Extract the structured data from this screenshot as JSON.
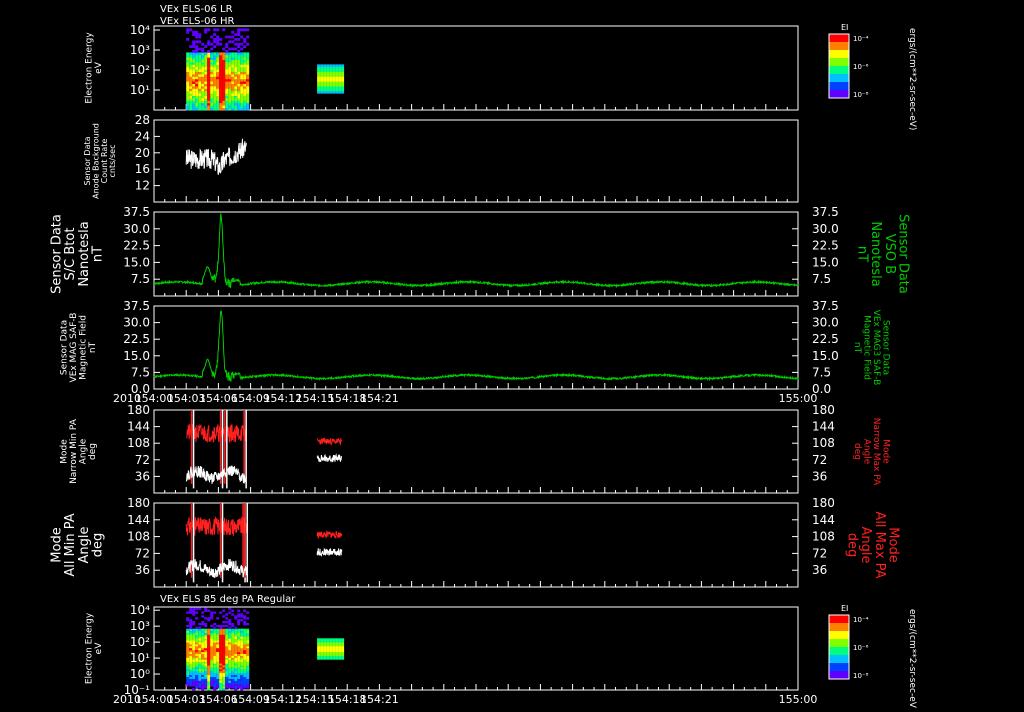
{
  "header": {
    "line1": "VEx ELS-06 LR",
    "line2": "VEx ELS-06 HR"
  },
  "bottom_title": "VEx ELS 85 deg PA Regular",
  "colorbar": {
    "label": "EI",
    "unit": "ergs/(cm**2-sr-sec-eV)",
    "ticks": [
      "10⁻⁴",
      "10⁻⁶",
      "10⁻⁸"
    ],
    "colors": [
      "#ff0000",
      "#ff8000",
      "#ffff00",
      "#80ff00",
      "#00ff80",
      "#00c0ff",
      "#0040ff",
      "#6000ff"
    ]
  },
  "time_axis": {
    "year_label": "2010",
    "ticks": [
      "154:00",
      "154:03",
      "154:06",
      "154:09",
      "154:12",
      "154:15",
      "154:18",
      "154:21",
      "155:00"
    ]
  },
  "colors": {
    "bfield": "#00cc00",
    "minpa": "#ffffff",
    "maxpa": "#ff2020",
    "axis": "#ffffff"
  },
  "chart_data": [
    {
      "type": "heatmap",
      "ylabel": [
        "Electron Energy",
        "eV"
      ],
      "yticks": [
        "10⁴",
        "10³",
        "10²",
        "10¹"
      ],
      "ylog_range": [
        0,
        4.2
      ],
      "coverage_minutes": [
        [
          3.0,
          8.6
        ],
        [
          15.2,
          17.5
        ]
      ]
    },
    {
      "type": "line",
      "ylabel": [
        "Sensor Data",
        "Anode Background",
        "Count Rate",
        "cnts/sec"
      ],
      "yticks": [
        28,
        24,
        20,
        16,
        12
      ],
      "ylim": [
        8,
        28
      ],
      "series": [
        {
          "segment": [
            3.0,
            8.6
          ],
          "seed": 3,
          "shape": "bg"
        }
      ]
    },
    {
      "type": "line",
      "ylabel": [
        "Sensor Data",
        "S/C Btot",
        "Nanotesla",
        "nT"
      ],
      "ylabel_right": [
        "Sensor Data",
        "VSO B",
        "Nanotesla",
        "nT"
      ],
      "yticks": [
        "37.5",
        "30.0",
        "22.5",
        "15.0",
        "7.5"
      ],
      "ylim": [
        0,
        37.5
      ],
      "series": [
        {
          "segment": [
            0,
            60
          ],
          "seed": 7,
          "shape": "bfield"
        }
      ]
    },
    {
      "type": "line",
      "ylabel": [
        "Sensor Data",
        "VEx MAG SAF-B",
        "Magnetic Field",
        "nT"
      ],
      "ylabel_right": [
        "Sensor Data",
        "VEx MAG3 SAF-B",
        "Magnetic Field",
        "nT"
      ],
      "yticks": [
        "37.5",
        "30.0",
        "22.5",
        "15.0",
        "7.5",
        "0.0"
      ],
      "ylim": [
        0,
        37.5
      ],
      "series": [
        {
          "segment": [
            0,
            60
          ],
          "seed": 11,
          "shape": "bfield"
        }
      ]
    },
    {
      "type": "line",
      "ylabel": [
        "Mode",
        "Narrow Min PA",
        "Angle",
        "deg"
      ],
      "ylabel_right": [
        "Mode",
        "Narrow Max PA",
        "Angle",
        "deg"
      ],
      "yticks": [
        180,
        144,
        108,
        72,
        36
      ],
      "ylim": [
        0,
        180
      ],
      "series": [
        {
          "segment": [
            3.0,
            8.6
          ],
          "seed": 21,
          "shape": "pamax",
          "spikes": [
            3.5,
            6.2,
            6.6,
            8.4
          ]
        },
        {
          "segment": [
            3.0,
            8.6
          ],
          "seed": 22,
          "shape": "pamin"
        },
        {
          "segment": [
            15.2,
            17.5
          ],
          "seed": 23,
          "shape": "pamax2"
        },
        {
          "segment": [
            15.2,
            17.5
          ],
          "seed": 24,
          "shape": "pamin2"
        }
      ]
    },
    {
      "type": "line",
      "ylabel": [
        "Mode",
        "All Min PA",
        "Angle",
        "deg"
      ],
      "ylabel_right": [
        "Mode",
        "All Max PA",
        "Angle",
        "deg"
      ],
      "yticks": [
        180,
        144,
        108,
        72,
        36
      ],
      "ylim": [
        0,
        180
      ],
      "series": [
        {
          "segment": [
            3.0,
            8.6
          ],
          "seed": 31,
          "shape": "pamax",
          "spikes": [
            3.5,
            6.2,
            8.3,
            8.5
          ]
        },
        {
          "segment": [
            3.0,
            8.6
          ],
          "seed": 32,
          "shape": "pamin"
        },
        {
          "segment": [
            15.2,
            17.5
          ],
          "seed": 33,
          "shape": "pamax2"
        },
        {
          "segment": [
            15.2,
            17.5
          ],
          "seed": 34,
          "shape": "pamin2"
        }
      ]
    },
    {
      "type": "heatmap",
      "ylabel": [
        "Electron Energy",
        "eV"
      ],
      "yticks": [
        "10⁴",
        "10³",
        "10²",
        "10¹",
        "10⁰",
        "10⁻¹"
      ],
      "ylog_range": [
        -1,
        4.2
      ],
      "coverage_minutes": [
        [
          3.0,
          8.6
        ],
        [
          15.2,
          17.5
        ]
      ]
    }
  ]
}
